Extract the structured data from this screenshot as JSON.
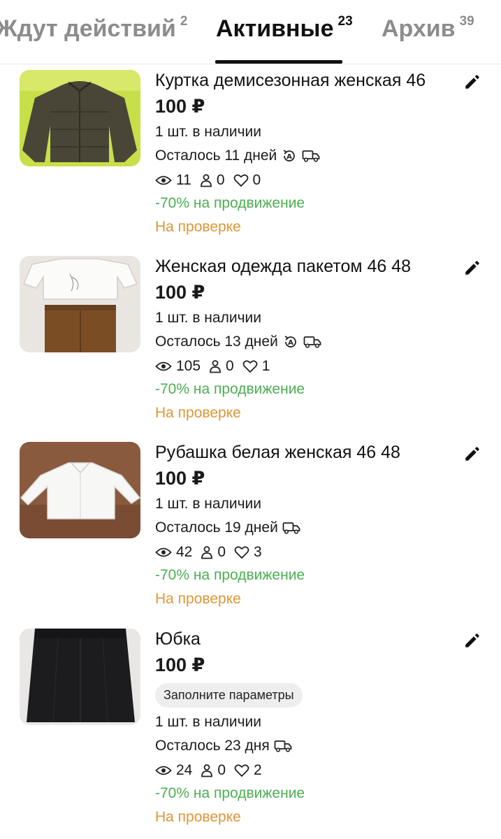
{
  "tabs": [
    {
      "label": "Ждут действий",
      "count": "2"
    },
    {
      "label": "Активные",
      "count": "23"
    },
    {
      "label": "Архив",
      "count": "39"
    }
  ],
  "active_tab": "Активные",
  "listings": [
    {
      "title": "Куртка демисезонная женская 46",
      "price": "100 ₽",
      "stock": "1 шт. в наличии",
      "remaining": "Осталось 11 дней",
      "views": "11",
      "contacts": "0",
      "favorites": "0",
      "promo": "-70% на продвижение",
      "status": "На проверке",
      "icons": [
        "eye-icon",
        "person-icon",
        "heart-icon",
        "auto-renew-icon",
        "delivery-truck-icon",
        "pencil-icon"
      ]
    },
    {
      "title": "Женская одежда пакетом 46 48",
      "price": "100 ₽",
      "stock": "1 шт. в наличии",
      "remaining": "Осталось 13 дней",
      "views": "105",
      "contacts": "0",
      "favorites": "1",
      "promo": "-70% на продвижение",
      "status": "На проверке",
      "icons": [
        "eye-icon",
        "person-icon",
        "heart-icon",
        "auto-renew-icon",
        "delivery-truck-icon",
        "pencil-icon"
      ]
    },
    {
      "title": "Рубашка белая женская 46 48",
      "price": "100 ₽",
      "stock": "1 шт. в наличии",
      "remaining": "Осталось 19 дней",
      "views": "42",
      "contacts": "0",
      "favorites": "3",
      "promo": "-70% на продвижение",
      "status": "На проверке",
      "icons": [
        "eye-icon",
        "person-icon",
        "heart-icon",
        "delivery-truck-icon",
        "pencil-icon"
      ]
    },
    {
      "title": "Юбка",
      "price": "100 ₽",
      "chip": "Заполните параметры",
      "stock": "1 шт. в наличии",
      "remaining": "Осталось 23 дня",
      "views": "24",
      "contacts": "0",
      "favorites": "2",
      "promo": "-70% на продвижение",
      "status": "На проверке",
      "icons": [
        "eye-icon",
        "person-icon",
        "heart-icon",
        "delivery-truck-icon",
        "pencil-icon"
      ]
    }
  ],
  "colors": {
    "promo": "#4caf50",
    "status": "#e09633",
    "tab_inactive": "#8c8c8c",
    "tab_active": "#111111"
  }
}
